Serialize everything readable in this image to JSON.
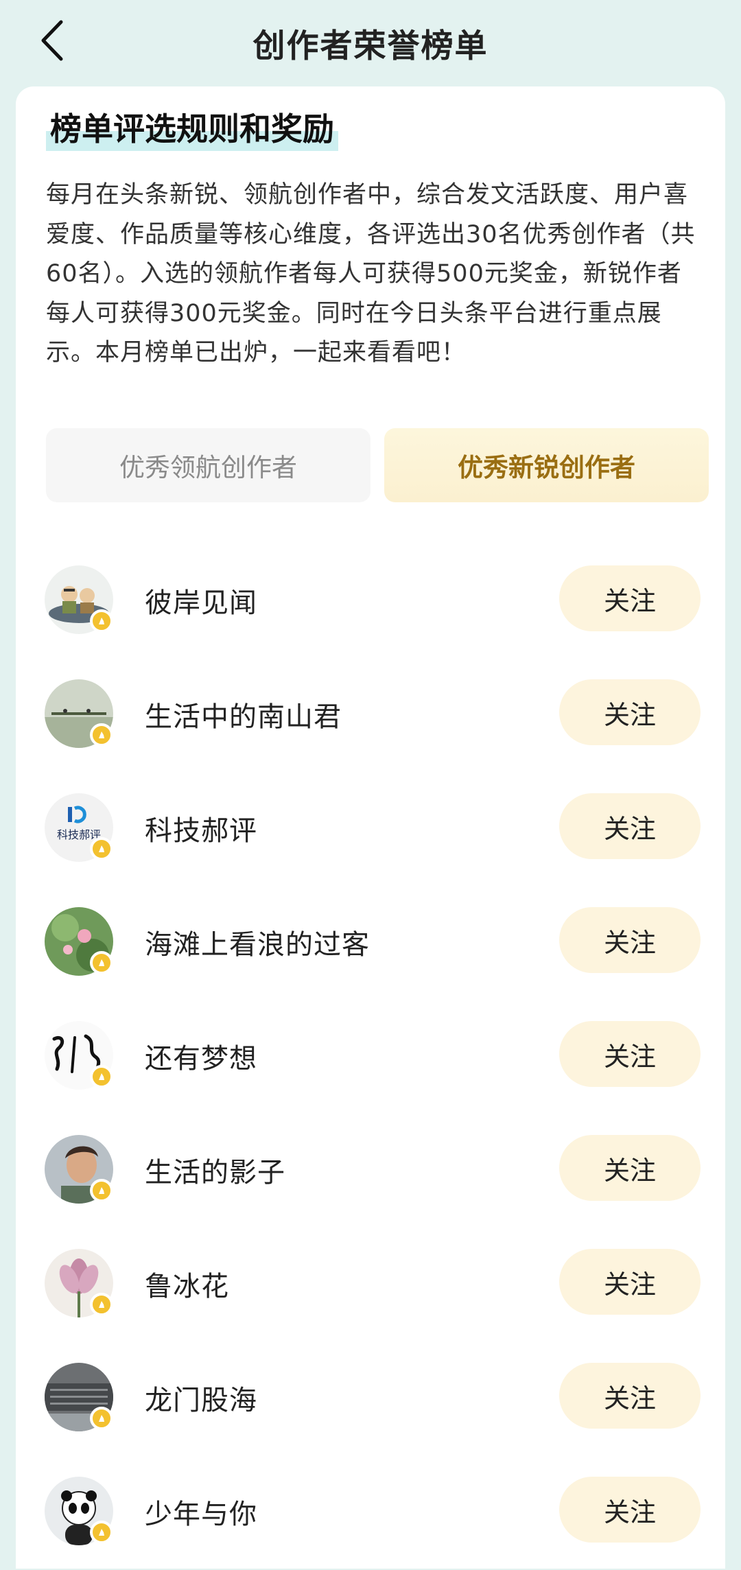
{
  "header": {
    "title": "创作者荣誉榜单",
    "back_icon": "chevron-left-icon"
  },
  "rules": {
    "title": "榜单评选规则和奖励",
    "text": "每月在头条新锐、领航创作者中，综合发文活跃度、用户喜爱度、作品质量等核心维度，各评选出30名优秀创作者（共60名）。入选的领航作者每人可获得500元奖金，新锐作者每人可获得300元奖金。同时在今日头条平台进行重点展示。本月榜单已出炉，一起来看看吧！"
  },
  "tabs": [
    {
      "label": "优秀领航创作者",
      "active": false
    },
    {
      "label": "优秀新锐创作者",
      "active": true
    }
  ],
  "creators": [
    {
      "name": "彼岸见闻",
      "follow_label": "关注"
    },
    {
      "name": "生活中的南山君",
      "follow_label": "关注"
    },
    {
      "name": "科技郝评",
      "follow_label": "关注",
      "avatar_text": "科技郝评"
    },
    {
      "name": "海滩上看浪的过客",
      "follow_label": "关注"
    },
    {
      "name": "还有梦想",
      "follow_label": "关注"
    },
    {
      "name": "生活的影子",
      "follow_label": "关注"
    },
    {
      "name": "鲁冰花",
      "follow_label": "关注"
    },
    {
      "name": "龙门股海",
      "follow_label": "关注"
    },
    {
      "name": "少年与你",
      "follow_label": "关注"
    }
  ],
  "colors": {
    "page_bg": "#e3f2f0",
    "accent_gold": "#9a6e12",
    "follow_bg": "#fdf4dd",
    "badge": "#f3c12f"
  }
}
